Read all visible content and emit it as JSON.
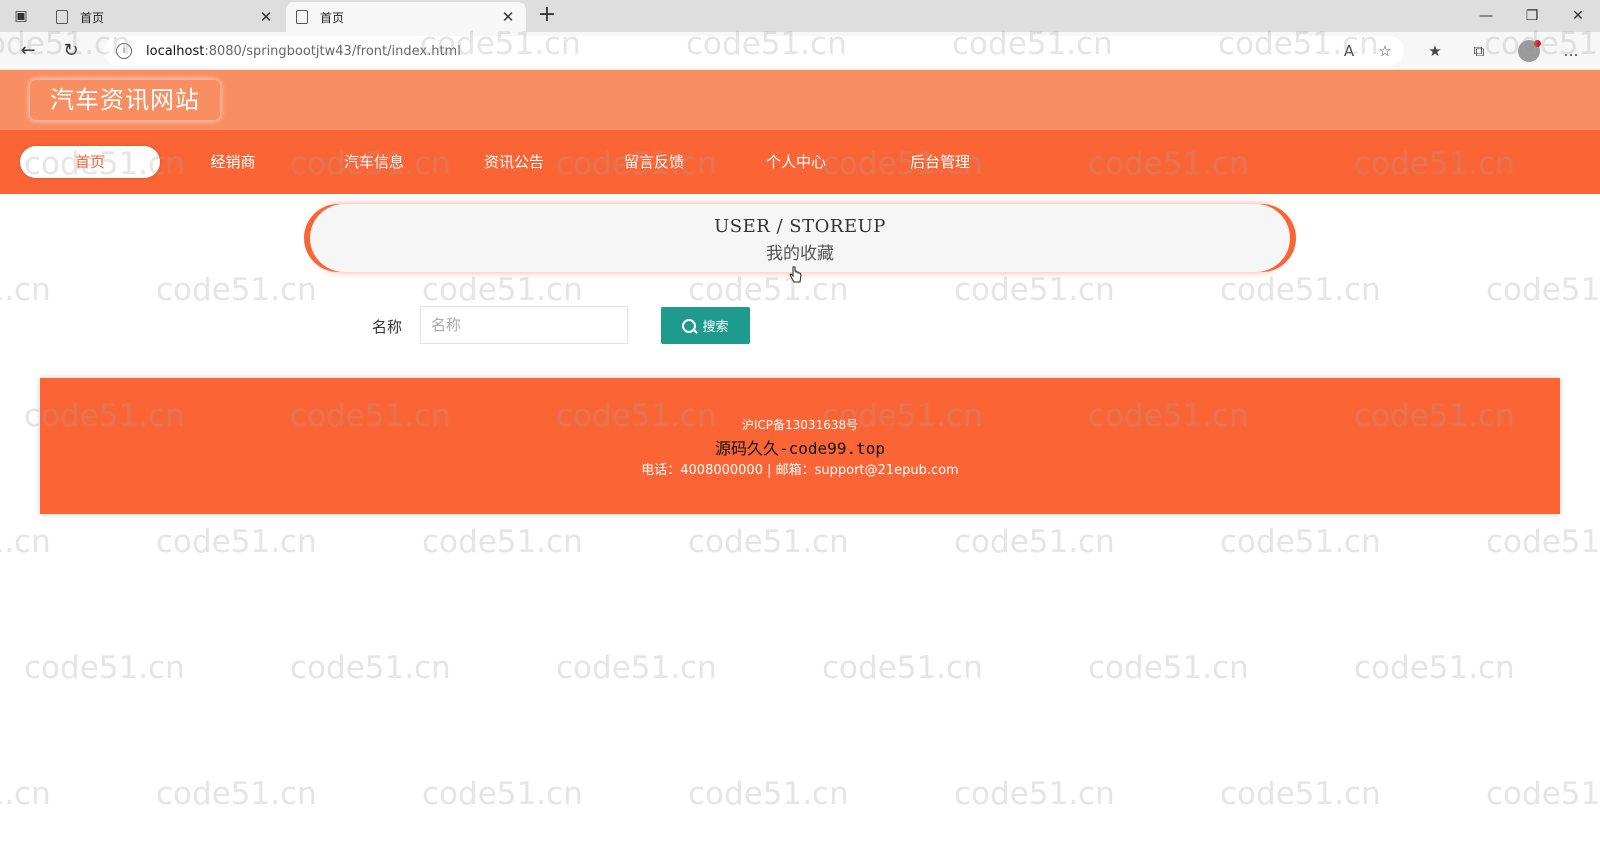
{
  "browser": {
    "tabs": [
      {
        "title": "首页",
        "active": false
      },
      {
        "title": "首页",
        "active": true
      }
    ],
    "url_host": "localhost",
    "url_path": ":8080/springbootjtw43/front/index.html",
    "window_controls": {
      "minimize": "—",
      "restore": "❐",
      "close": "✕"
    }
  },
  "site": {
    "title": "汽车资讯网站",
    "nav": [
      {
        "label": "首页",
        "active": true
      },
      {
        "label": "经销商",
        "active": false
      },
      {
        "label": "汽车信息",
        "active": false
      },
      {
        "label": "资讯公告",
        "active": false
      },
      {
        "label": "留言反馈",
        "active": false
      },
      {
        "label": "个人中心",
        "active": false
      },
      {
        "label": "后台管理",
        "active": false
      }
    ],
    "colors": {
      "header": "#fa8e63",
      "nav": "#fb6536",
      "search_button": "#1e9b8d"
    }
  },
  "breadcrumb": {
    "en": "USER / STOREUP",
    "cn": "我的收藏"
  },
  "search": {
    "label": "名称",
    "placeholder": "名称",
    "value": "",
    "button": "搜索"
  },
  "footer": {
    "icp": "沪ICP备13031638号",
    "brand": "源码久久-code99.top",
    "contact": "电话：4008000000 | 邮箱：support@21epub.com"
  },
  "watermark": "code51.cn"
}
